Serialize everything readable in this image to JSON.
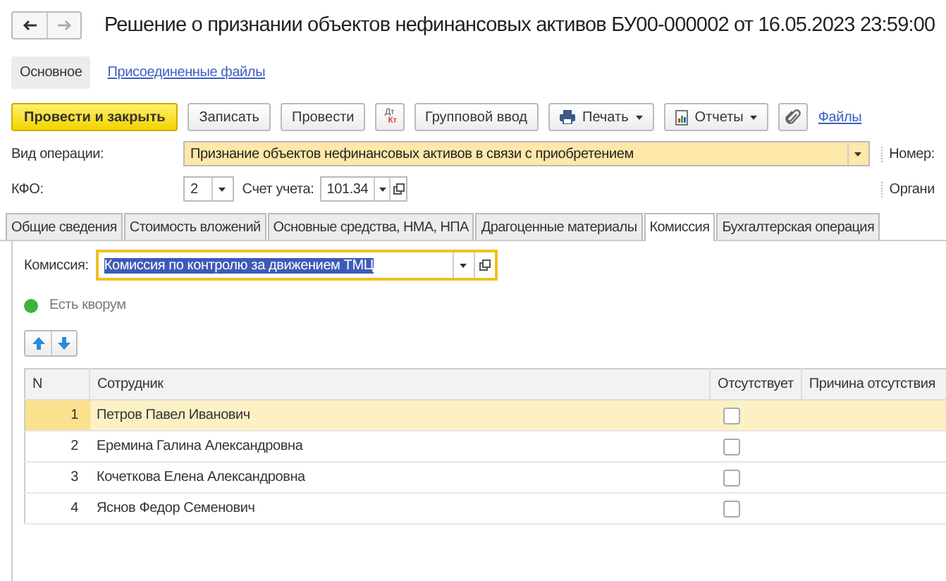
{
  "window": {
    "title": "Решение о признании объектов нефинансовых активов БУ00-000002 от 16.05.2023 23:59:00"
  },
  "sections": [
    {
      "label": "Основное",
      "selected": true
    },
    {
      "label": "Присоединенные файлы",
      "selected": false
    }
  ],
  "toolbar": [
    {
      "kind": "primary",
      "label": "Провести и закрыть"
    },
    {
      "kind": "button",
      "label": "Записать"
    },
    {
      "kind": "button",
      "label": "Провести"
    },
    {
      "kind": "dtkt",
      "label": "Дт",
      "sub": "Кт"
    },
    {
      "kind": "button",
      "label": "Групповой ввод"
    },
    {
      "kind": "print",
      "label": "Печать"
    },
    {
      "kind": "reports",
      "label": "Отчеты"
    },
    {
      "kind": "clip"
    },
    {
      "kind": "link",
      "label": "Файлы"
    }
  ],
  "operation": {
    "label": "Вид операции:",
    "value": "Признание объектов нефинансовых активов в связи с приобретением"
  },
  "number_label": "Номер:",
  "kfo": {
    "label": "КФО:",
    "value": "2"
  },
  "account": {
    "label": "Счет учета:",
    "value": "101.34"
  },
  "org_label": "Органи",
  "tabs": [
    {
      "label": "Общие сведения",
      "selected": false
    },
    {
      "label": "Стоимость вложений",
      "selected": false
    },
    {
      "label": "Основные средства, НМА, НПА",
      "selected": false
    },
    {
      "label": "Драгоценные материалы",
      "selected": false
    },
    {
      "label": "Комиссия",
      "selected": true
    },
    {
      "label": "Бухгалтерская операция",
      "selected": false
    }
  ],
  "commission": {
    "label": "Комиссия:",
    "value": "Комиссия по контролю за движением ТМЦ"
  },
  "quorum": {
    "text": "Есть кворум",
    "color": "#3cb43c"
  },
  "table": {
    "columns": [
      "N",
      "Сотрудник",
      "Отсутствует",
      "Причина отсутствия"
    ],
    "rows": [
      {
        "n": "1",
        "name": "Петров Павел Иванович",
        "absent": false,
        "selected": true
      },
      {
        "n": "2",
        "name": "Еремина Галина Александровна",
        "absent": false,
        "selected": false
      },
      {
        "n": "3",
        "name": "Кочеткова Елена Александровна",
        "absent": false,
        "selected": false
      },
      {
        "n": "4",
        "name": "Яснов Федор Семенович",
        "absent": false,
        "selected": false
      }
    ]
  }
}
